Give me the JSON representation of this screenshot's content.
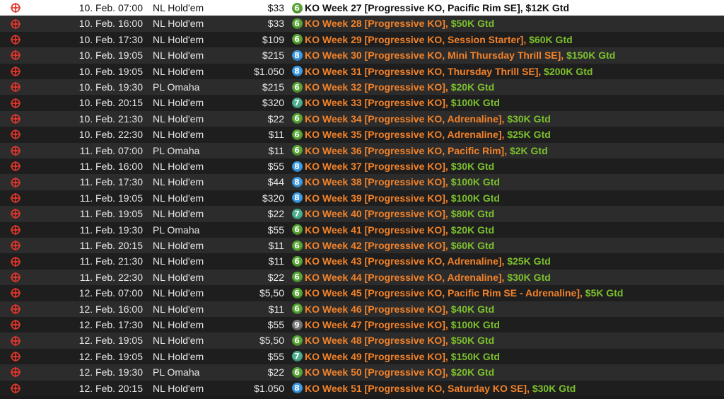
{
  "colors": {
    "name_text": "#f2822a",
    "guarantee_text": "#7cc02d",
    "selected_row_bg": "#ffffff",
    "status_icon": "#e0362c",
    "badge_6": "#58a636",
    "badge_7": "#4cae8f",
    "badge_8": "#3f9be3",
    "badge_9": "#777777"
  },
  "rows": [
    {
      "date": "10. Feb.",
      "time": "07:00",
      "game": "NL Hold'em",
      "buyin": "$33",
      "seats": "6",
      "name": "KO Week 27 [Progressive KO, Pacific Rim SE],",
      "gtd": " $12K Gtd",
      "selected": true,
      "icon": "crosshair-icon"
    },
    {
      "date": "10. Feb.",
      "time": "16:00",
      "game": "NL Hold'em",
      "buyin": "$33",
      "seats": "6",
      "name": "KO Week 28 [Progressive KO],",
      "gtd": " $50K Gtd",
      "icon": "crosshair-icon"
    },
    {
      "date": "10. Feb.",
      "time": "17:30",
      "game": "NL Hold'em",
      "buyin": "$109",
      "seats": "6",
      "name": "KO Week 29 [Progressive KO, Session Starter],",
      "gtd": " $60K Gtd",
      "icon": "crosshair-icon"
    },
    {
      "date": "10. Feb.",
      "time": "19:05",
      "game": "NL Hold'em",
      "buyin": "$215",
      "seats": "8",
      "name": "KO Week 30 [Progressive KO, Mini Thursday Thrill SE],",
      "gtd": " $150K Gtd",
      "icon": "crosshair-icon"
    },
    {
      "date": "10. Feb.",
      "time": "19:05",
      "game": "NL Hold'em",
      "buyin": "$1.050",
      "seats": "8",
      "name": "KO Week 31 [Progressive KO, Thursday Thrill SE],",
      "gtd": " $200K Gtd",
      "icon": "crosshair-icon"
    },
    {
      "date": "10. Feb.",
      "time": "19:30",
      "game": "PL Omaha",
      "buyin": "$215",
      "seats": "6",
      "name": "KO Week 32 [Progressive KO],",
      "gtd": " $20K Gtd",
      "icon": "crosshair-icon"
    },
    {
      "date": "10. Feb.",
      "time": "20:15",
      "game": "NL Hold'em",
      "buyin": "$320",
      "seats": "7",
      "name": "KO Week 33 [Progressive KO],",
      "gtd": " $100K Gtd",
      "icon": "crosshair-icon"
    },
    {
      "date": "10. Feb.",
      "time": "21:30",
      "game": "NL Hold'em",
      "buyin": "$22",
      "seats": "6",
      "name": "KO Week 34 [Progressive KO, Adrenaline],",
      "gtd": " $30K Gtd",
      "icon": "crosshair-icon"
    },
    {
      "date": "10. Feb.",
      "time": "22:30",
      "game": "NL Hold'em",
      "buyin": "$11",
      "seats": "6",
      "name": "KO Week 35 [Progressive KO, Adrenaline],",
      "gtd": " $25K Gtd",
      "icon": "crosshair-icon"
    },
    {
      "date": "11. Feb.",
      "time": "07:00",
      "game": "PL Omaha",
      "buyin": "$11",
      "seats": "6",
      "name": "KO Week 36 [Progressive KO, Pacific Rim],",
      "gtd": " $2K Gtd",
      "icon": "crosshair-icon"
    },
    {
      "date": "11. Feb.",
      "time": "16:00",
      "game": "NL Hold'em",
      "buyin": "$55",
      "seats": "8",
      "name": "KO Week 37 [Progressive KO],",
      "gtd": " $30K Gtd",
      "icon": "crosshair-icon"
    },
    {
      "date": "11. Feb.",
      "time": "17:30",
      "game": "NL Hold'em",
      "buyin": "$44",
      "seats": "8",
      "name": "KO Week 38 [Progressive KO],",
      "gtd": " $100K Gtd",
      "icon": "crosshair-icon"
    },
    {
      "date": "11. Feb.",
      "time": "19:05",
      "game": "NL Hold'em",
      "buyin": "$320",
      "seats": "8",
      "name": "KO Week 39 [Progressive KO],",
      "gtd": " $100K Gtd",
      "icon": "crosshair-icon"
    },
    {
      "date": "11. Feb.",
      "time": "19:05",
      "game": "NL Hold'em",
      "buyin": "$22",
      "seats": "7",
      "name": "KO Week 40 [Progressive KO],",
      "gtd": " $80K Gtd",
      "icon": "crosshair-icon"
    },
    {
      "date": "11. Feb.",
      "time": "19:30",
      "game": "PL Omaha",
      "buyin": "$55",
      "seats": "6",
      "name": "KO Week 41 [Progressive KO],",
      "gtd": " $20K Gtd",
      "icon": "crosshair-icon"
    },
    {
      "date": "11. Feb.",
      "time": "20:15",
      "game": "NL Hold'em",
      "buyin": "$11",
      "seats": "6",
      "name": "KO Week 42 [Progressive KO],",
      "gtd": " $60K Gtd",
      "icon": "crosshair-icon"
    },
    {
      "date": "11. Feb.",
      "time": "21:30",
      "game": "NL Hold'em",
      "buyin": "$11",
      "seats": "6",
      "name": "KO Week 43 [Progressive KO, Adrenaline],",
      "gtd": " $25K Gtd",
      "icon": "crosshair-icon"
    },
    {
      "date": "11. Feb.",
      "time": "22:30",
      "game": "NL Hold'em",
      "buyin": "$22",
      "seats": "6",
      "name": "KO Week 44 [Progressive KO, Adrenaline],",
      "gtd": " $30K Gtd",
      "icon": "crosshair-icon"
    },
    {
      "date": "12. Feb.",
      "time": "07:00",
      "game": "NL Hold'em",
      "buyin": "$5,50",
      "seats": "6",
      "name": "KO Week 45 [Progressive KO, Pacific Rim SE - Adrenaline],",
      "gtd": " $5K Gtd",
      "icon": "crosshair-icon"
    },
    {
      "date": "12. Feb.",
      "time": "16:00",
      "game": "NL Hold'em",
      "buyin": "$11",
      "seats": "6",
      "name": "KO Week 46 [Progressive KO],",
      "gtd": " $40K Gtd",
      "icon": "crosshair-icon"
    },
    {
      "date": "12. Feb.",
      "time": "17:30",
      "game": "NL Hold'em",
      "buyin": "$55",
      "seats": "9",
      "name": "KO Week 47 [Progressive KO],",
      "gtd": " $100K Gtd",
      "icon": "crosshair-icon"
    },
    {
      "date": "12. Feb.",
      "time": "19:05",
      "game": "NL Hold'em",
      "buyin": "$5,50",
      "seats": "6",
      "name": "KO Week 48 [Progressive KO],",
      "gtd": " $50K Gtd",
      "icon": "crosshair-icon"
    },
    {
      "date": "12. Feb.",
      "time": "19:05",
      "game": "NL Hold'em",
      "buyin": "$55",
      "seats": "7",
      "name": "KO Week 49 [Progressive KO],",
      "gtd": " $150K Gtd",
      "icon": "crosshair-icon"
    },
    {
      "date": "12. Feb.",
      "time": "19:30",
      "game": "PL Omaha",
      "buyin": "$22",
      "seats": "6",
      "name": "KO Week 50 [Progressive KO],",
      "gtd": " $20K Gtd",
      "icon": "crosshair-icon"
    },
    {
      "date": "12. Feb.",
      "time": "20:15",
      "game": "NL Hold'em",
      "buyin": "$1.050",
      "seats": "8",
      "name": "KO Week 51 [Progressive KO, Saturday KO SE],",
      "gtd": " $30K Gtd",
      "icon": "crosshair-icon"
    }
  ]
}
